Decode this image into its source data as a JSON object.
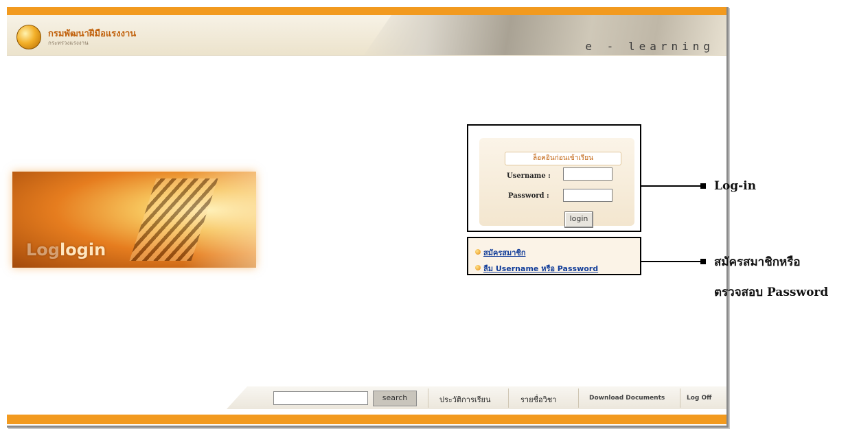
{
  "header": {
    "org_title": "กรมพัฒนาฝีมือแรงงาน",
    "org_subtitle": "กระทรวงแรงงาน",
    "banner_text": "e - learning"
  },
  "promo": {
    "ghost_text": "Log",
    "text": "login"
  },
  "login": {
    "title": "ล็อคอินก่อนเข้าเรียน",
    "username_label": "Username :",
    "username_value": "",
    "password_label": "Password :",
    "password_value": "",
    "button_label": "login"
  },
  "links": {
    "register": "สมัครสมาชิก",
    "forgot": "ลืม Username หรือ Password"
  },
  "annotations": {
    "login": "Log-in",
    "register_line1": "สมัครสมาชิกหรือ",
    "register_line2": "ตรวจสอบ Password"
  },
  "nav": {
    "search_value": "",
    "search_button": "search",
    "history": "ประวัติการเรียน",
    "courses": "รายชื่อวิชา",
    "downloads": "Download Documents",
    "logoff": "Log Off"
  },
  "colors": {
    "accent_orange": "#f29a1f",
    "brand_text": "#c1620d",
    "link_blue": "#123d99"
  }
}
